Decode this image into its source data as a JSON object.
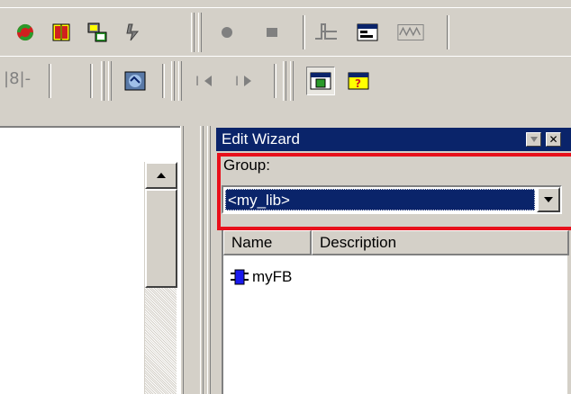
{
  "toolbar_row1": {
    "icons": [
      "refresh-icon",
      "book-icon",
      "network-icon",
      "tool-icon",
      "record-icon",
      "stop-icon",
      "waveform-icon",
      "window-icon",
      "signal-icon"
    ]
  },
  "toolbar_row2": {
    "label_fragment": "|8|-",
    "icons": [
      "online-icon",
      "step-back-icon",
      "step-forward-icon",
      "window-green-icon",
      "window-help-icon"
    ]
  },
  "edit_wizard": {
    "title": "Edit Wizard",
    "group_label": "Group:",
    "group_value": "<my_lib>",
    "columns": [
      "Name",
      "Description"
    ],
    "items": [
      {
        "name": "myFB",
        "icon": "function-block-icon"
      }
    ]
  },
  "colors": {
    "title_bar": "#0a246a",
    "highlight_box": "#e8101b",
    "face": "#d4d0c8"
  }
}
